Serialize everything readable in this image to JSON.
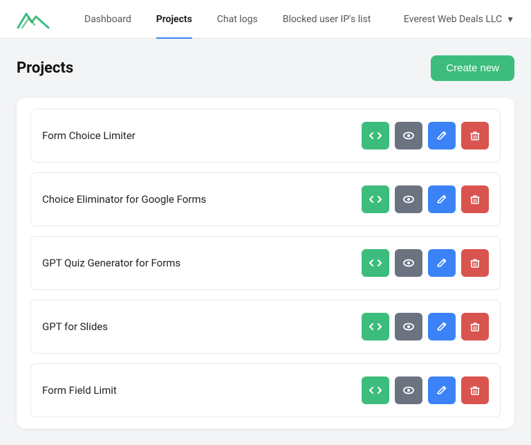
{
  "header": {
    "nav": [
      {
        "label": "Dashboard",
        "active": false,
        "id": "dashboard"
      },
      {
        "label": "Projects",
        "active": true,
        "id": "projects"
      },
      {
        "label": "Chat logs",
        "active": false,
        "id": "chatlogs"
      },
      {
        "label": "Blocked user IP's list",
        "active": false,
        "id": "blockedips"
      }
    ],
    "account": "Everest Web Deals LLC"
  },
  "page": {
    "title": "Projects",
    "create_button": "Create new"
  },
  "projects": [
    {
      "id": "p1",
      "name": "Form Choice Limiter"
    },
    {
      "id": "p2",
      "name": "Choice Eliminator for Google Forms"
    },
    {
      "id": "p3",
      "name": "GPT Quiz Generator for Forms"
    },
    {
      "id": "p4",
      "name": "GPT for Slides"
    },
    {
      "id": "p5",
      "name": "Form Field Limit"
    }
  ],
  "actions": {
    "code_title": "Code",
    "preview_title": "Preview",
    "edit_title": "Edit",
    "delete_title": "Delete"
  }
}
